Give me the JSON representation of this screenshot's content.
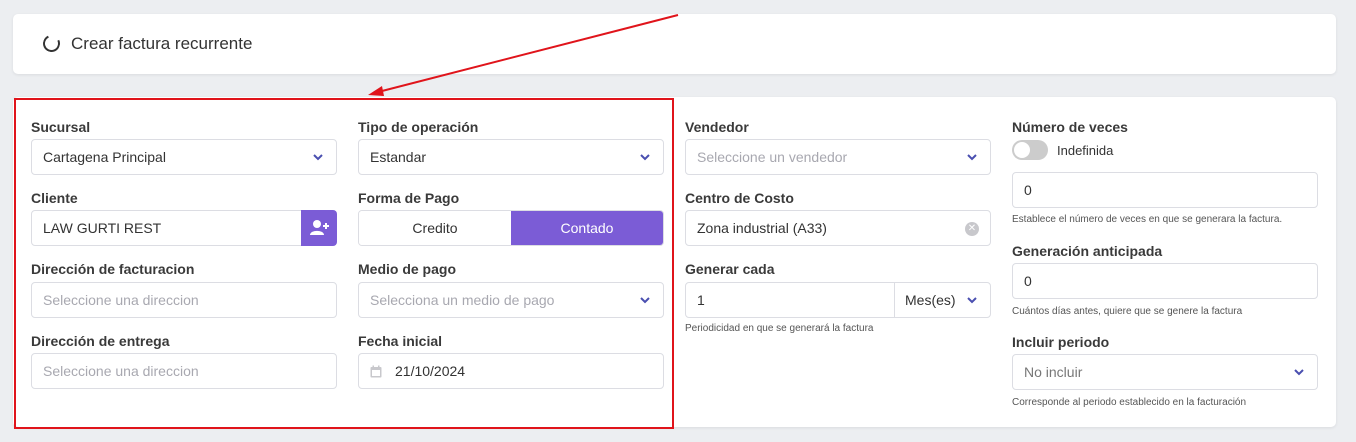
{
  "header": {
    "title": "Crear factura recurrente",
    "icon": "spinner-icon"
  },
  "col1": {
    "sucursal": {
      "label": "Sucursal",
      "value": "Cartagena Principal"
    },
    "cliente": {
      "label": "Cliente",
      "value": "LAW GURTI REST",
      "button_icon": "add-user-icon"
    },
    "direccion_facturacion": {
      "label": "Dirección de facturacion",
      "placeholder": "Seleccione una direccion"
    },
    "direccion_entrega": {
      "label": "Dirección de entrega",
      "placeholder": "Seleccione una direccion"
    }
  },
  "col2": {
    "tipo_operacion": {
      "label": "Tipo de operación",
      "value": "Estandar"
    },
    "forma_pago": {
      "label": "Forma de Pago",
      "options": [
        "Credito",
        "Contado"
      ],
      "selected": "Contado"
    },
    "medio_pago": {
      "label": "Medio de pago",
      "placeholder": "Selecciona un medio de pago"
    },
    "fecha_inicial": {
      "label": "Fecha inicial",
      "value": "21/10/2024",
      "icon": "calendar-icon"
    }
  },
  "col3": {
    "vendedor": {
      "label": "Vendedor",
      "placeholder": "Seleccione un vendedor"
    },
    "centro_costo": {
      "label": "Centro de Costo",
      "value": "Zona industrial (A33)"
    },
    "generar_cada": {
      "label": "Generar cada",
      "value": "1",
      "unit": "Mes(es)",
      "help": "Periodicidad en que se generará la factura"
    }
  },
  "col4": {
    "numero_veces": {
      "label": "Número de veces",
      "toggle_label": "Indefinida",
      "value": "0",
      "help": "Establece el número de veces en que se generara la factura."
    },
    "generacion_anticipada": {
      "label": "Generación anticipada",
      "value": "0",
      "help": "Cuántos días antes, quiere que se genere la factura"
    },
    "incluir_periodo": {
      "label": "Incluir periodo",
      "value": "No incluir",
      "help": "Corresponde al periodo establecido en la facturación"
    }
  },
  "colors": {
    "accent": "#7b5cd6",
    "highlight": "#e0141b",
    "chevron": "#4a4fb0"
  }
}
